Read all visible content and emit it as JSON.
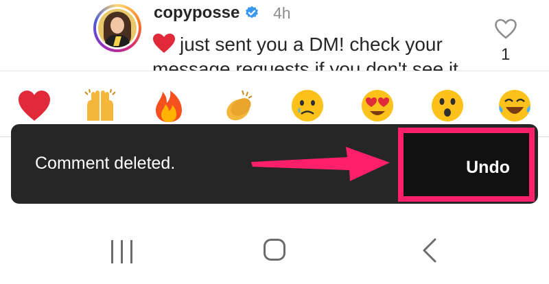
{
  "comment": {
    "username": "copyposse",
    "time": "4h",
    "text_line1": "just sent you a DM! check your",
    "text_line2": "message requests if you don't see it",
    "like_count": "1"
  },
  "reactions": [
    {
      "name": "red-heart",
      "glyph": "❤️"
    },
    {
      "name": "raising-hands",
      "glyph": "🙌"
    },
    {
      "name": "fire",
      "glyph": "🔥"
    },
    {
      "name": "clapping-hands",
      "glyph": "👏"
    },
    {
      "name": "crying-face",
      "glyph": "😢"
    },
    {
      "name": "heart-eyes-face",
      "glyph": "😍"
    },
    {
      "name": "surprised-face",
      "glyph": "😮"
    },
    {
      "name": "tears-of-joy-face",
      "glyph": "😂"
    }
  ],
  "snackbar": {
    "message": "Comment deleted.",
    "action_label": "Undo"
  },
  "colors": {
    "snackbar_bg": "#262626",
    "highlight": "#ff1f6a",
    "verified_blue": "#3897f0",
    "nav_gray": "#6b6b6b"
  }
}
